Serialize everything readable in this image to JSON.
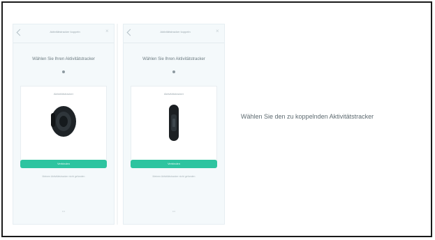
{
  "caption": {
    "text": "Wählen Sie den zu koppelnden Aktivitätstracker"
  },
  "screens": [
    {
      "topbar_title": "Aktivitätstracker koppeln",
      "heading": "Wählen Sie Ihren Aktivitätstracker",
      "card_label": "Aktivitätstracker",
      "device": "smartwatch",
      "pager": "•••",
      "cta_label": "Verbinden",
      "footer_link": "Meinen Aktivitätstracker nicht gefunden"
    },
    {
      "topbar_title": "Aktivitätstracker koppeln",
      "heading": "Wählen Sie Ihren Aktivitätstracker",
      "card_label": "Aktivitätstracker",
      "device": "fitness-band",
      "pager": "•••",
      "cta_label": "Verbinden",
      "footer_link": "Meinen Aktivitätstracker nicht gefunden"
    }
  ],
  "colors": {
    "accent": "#2ec4a0",
    "screen_bg": "#f4f9fb"
  }
}
